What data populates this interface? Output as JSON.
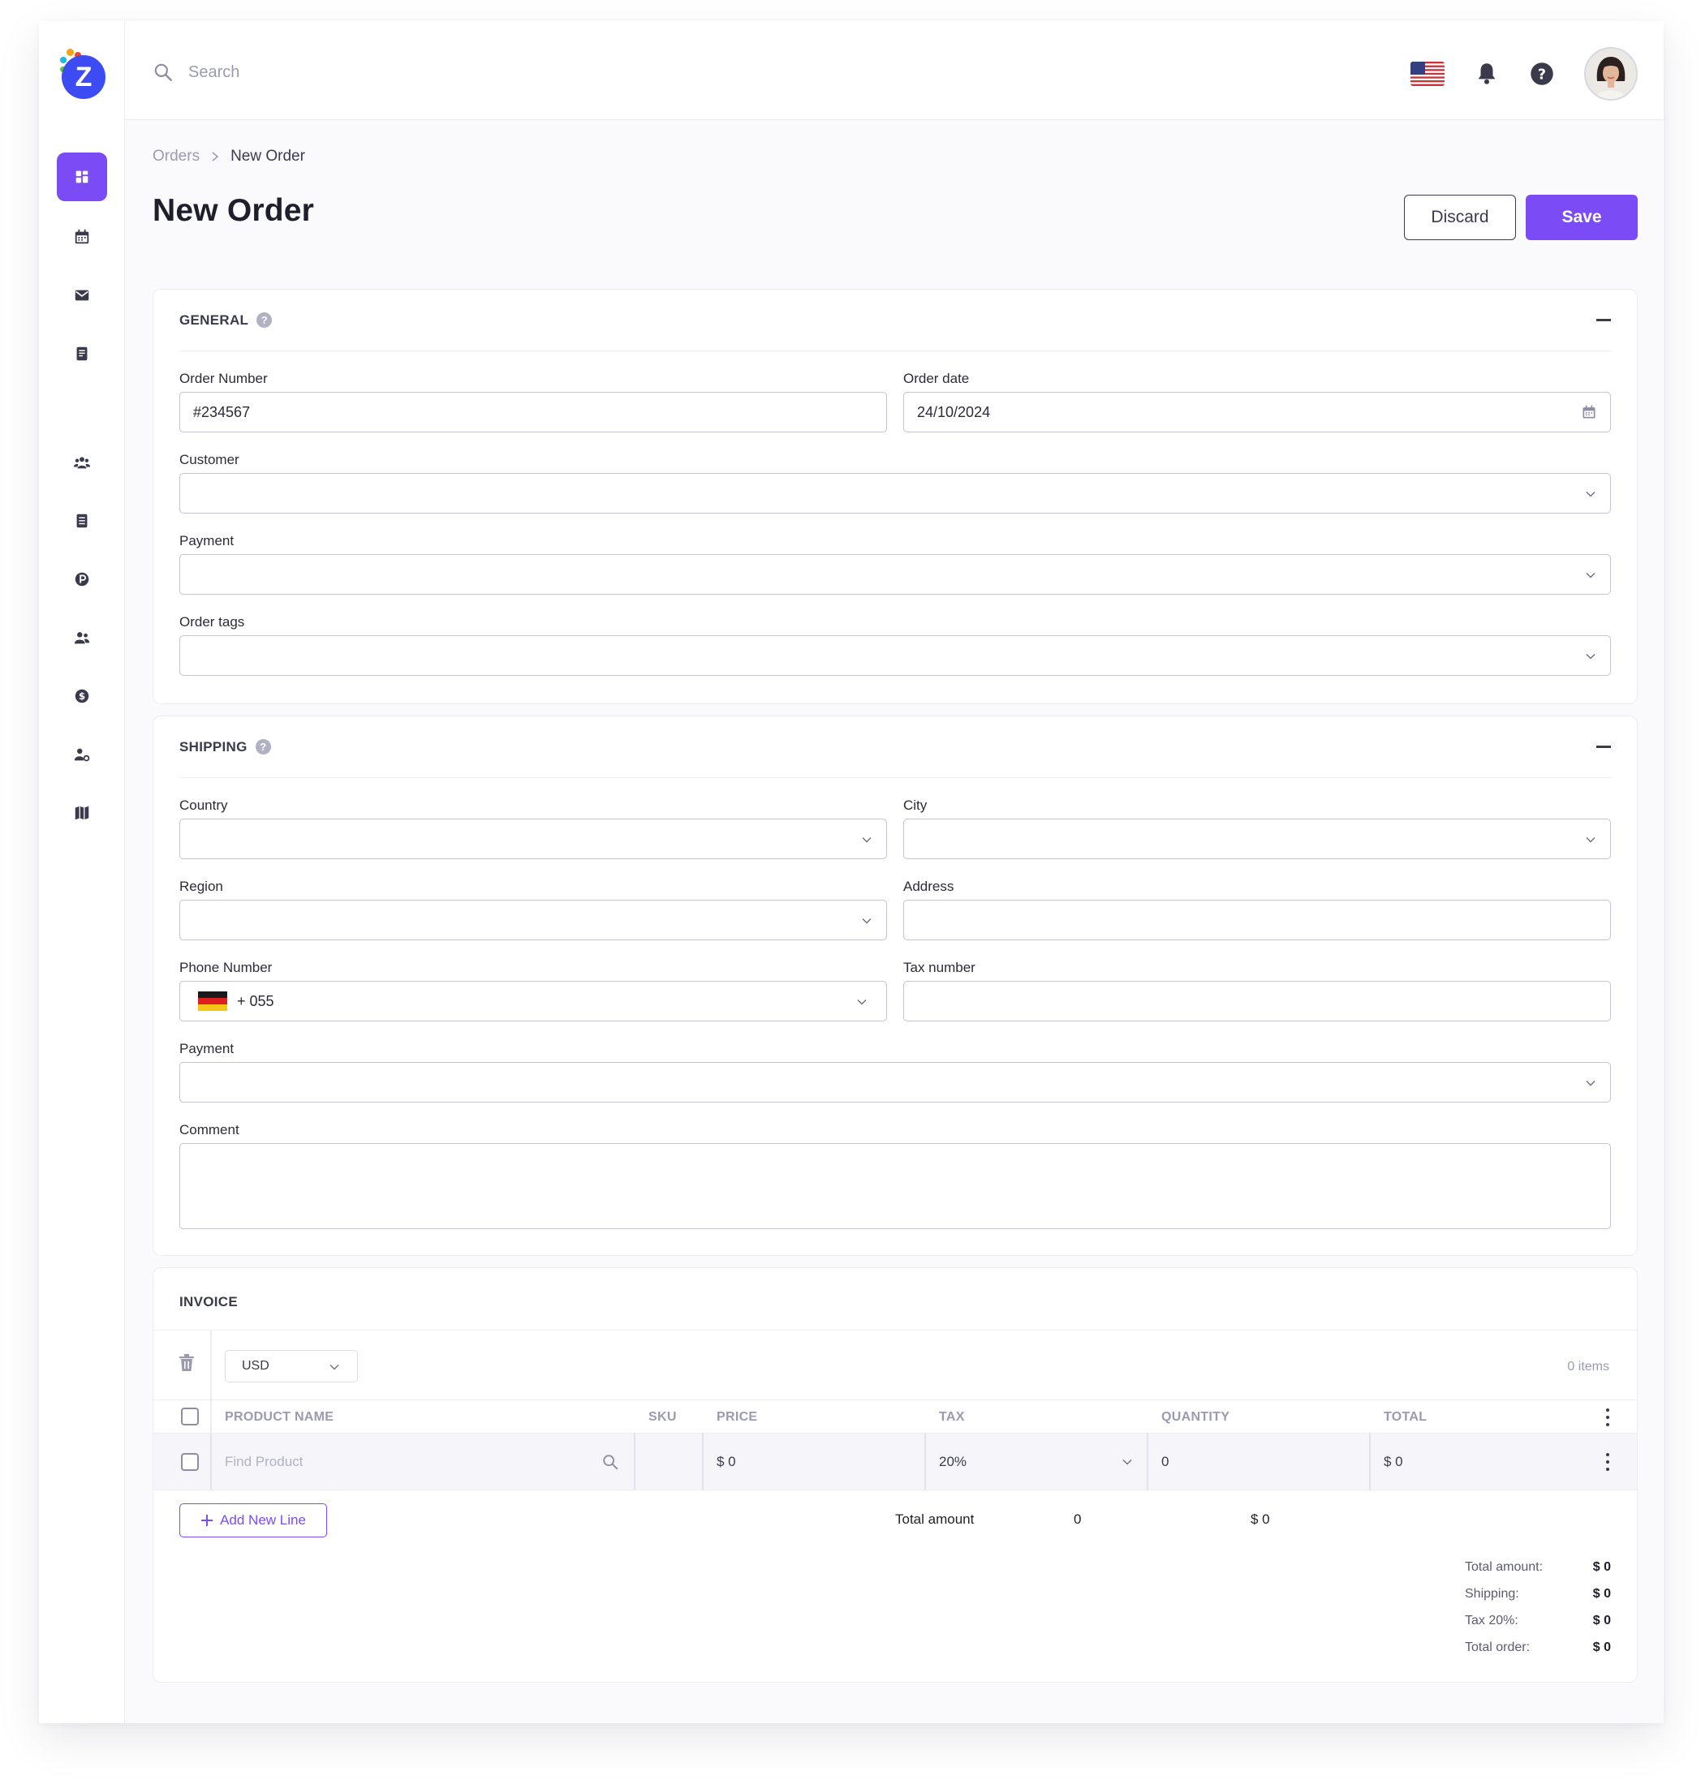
{
  "app": {
    "logo_letter": "Z"
  },
  "search": {
    "placeholder": "Search"
  },
  "breadcrumb": {
    "parent": "Orders",
    "separator": "›",
    "current": "New Order"
  },
  "page": {
    "title": "New Order",
    "discard_label": "Discard",
    "save_label": "Save"
  },
  "general": {
    "title": "GENERAL",
    "help": "?",
    "order_number_label": "Order Number",
    "order_number_value": "#234567",
    "order_date_label": "Order date",
    "order_date_value": "24/10/2024",
    "customer_label": "Customer",
    "payment_label": "Payment",
    "order_tags_label": "Order tags"
  },
  "shipping": {
    "title": "SHIPPING",
    "help": "?",
    "country_label": "Country",
    "city_label": "City",
    "region_label": "Region",
    "address_label": "Address",
    "phone_label": "Phone Number",
    "phone_code": "+ 055",
    "tax_label": "Tax number",
    "payment_label": "Payment",
    "comment_label": "Comment"
  },
  "invoice": {
    "title": "INVOICE",
    "currency": "USD",
    "items_count": "0 items",
    "columns": [
      "PRODUCT NAME",
      "SKU",
      "PRICE",
      "TAX",
      "QUANTITY",
      "TOTAL"
    ],
    "row": {
      "product_placeholder": "Find Product",
      "price": "$ 0",
      "tax": "20%",
      "quantity": "0",
      "total": "$ 0"
    },
    "add_line_label": "Add New Line",
    "total_amount_label": "Total amount",
    "total_quantity": "0",
    "total_value": "$ 0",
    "summary": [
      {
        "label": "Total amount:",
        "value": "$ 0"
      },
      {
        "label": "Shipping:",
        "value": "$ 0"
      },
      {
        "label": "Tax 20%:",
        "value": "$ 0"
      },
      {
        "label": "Total order:",
        "value": "$ 0"
      }
    ]
  },
  "icons": [
    "dashboard-icon",
    "calendar-icon",
    "mail-icon",
    "invoice-icon",
    "team-icon",
    "document-icon",
    "parking-icon",
    "users-icon",
    "dollar-icon",
    "user-settings-icon",
    "map-icon",
    "search-icon",
    "us-flag-icon",
    "bell-icon",
    "help-icon",
    "german-flag-icon",
    "trash-icon",
    "chevron-down-icon",
    "kebab-icon"
  ],
  "colors": {
    "accent": "#7b4cf5",
    "logo": "#3d4cf2",
    "text": "#1f1f2b",
    "muted": "#9a9bb0",
    "border": "#c4c4d2"
  }
}
